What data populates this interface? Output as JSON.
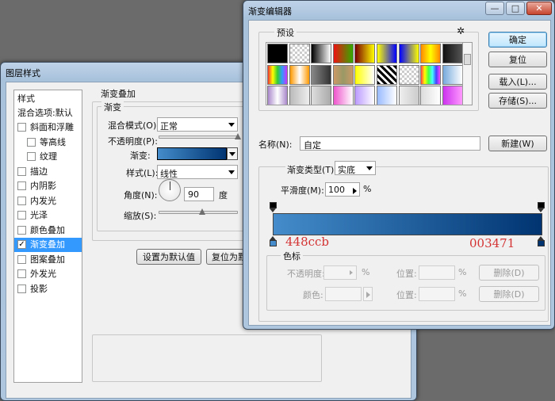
{
  "layer_style": {
    "title": "图层样式",
    "styles_header": "样式",
    "blend_options": "混合选项:默认",
    "items": [
      {
        "label": "斜面和浮雕",
        "checked": false,
        "indent": false,
        "selected": false
      },
      {
        "label": "等高线",
        "checked": false,
        "indent": true,
        "selected": false
      },
      {
        "label": "纹理",
        "checked": false,
        "indent": true,
        "selected": false
      },
      {
        "label": "描边",
        "checked": false,
        "indent": false,
        "selected": false
      },
      {
        "label": "内阴影",
        "checked": false,
        "indent": false,
        "selected": false
      },
      {
        "label": "内发光",
        "checked": false,
        "indent": false,
        "selected": false
      },
      {
        "label": "光泽",
        "checked": false,
        "indent": false,
        "selected": false
      },
      {
        "label": "颜色叠加",
        "checked": false,
        "indent": false,
        "selected": false
      },
      {
        "label": "渐变叠加",
        "checked": true,
        "indent": false,
        "selected": true
      },
      {
        "label": "图案叠加",
        "checked": false,
        "indent": false,
        "selected": false
      },
      {
        "label": "外发光",
        "checked": false,
        "indent": false,
        "selected": false
      },
      {
        "label": "投影",
        "checked": false,
        "indent": false,
        "selected": false
      }
    ],
    "panel_title": "渐变叠加",
    "group_title": "渐变",
    "blend_mode_label": "混合模式(O):",
    "blend_mode_value": "正常",
    "opacity_label": "不透明度(P):",
    "opacity_level": 1.0,
    "gradient_label": "渐变:",
    "style_label": "样式(L):",
    "style_value": "线性",
    "angle_label": "角度(N):",
    "angle_value": "90",
    "angle_unit": "度",
    "scale_label": "缩放(S):",
    "scale_level": 0.55,
    "btn_set_default": "设置为默认值",
    "btn_reset_default": "复位为默"
  },
  "gradient_editor": {
    "title": "渐变编辑器",
    "window_buttons": {
      "minimize": "—",
      "maximize": "□",
      "close": "✕"
    },
    "presets_label": "预设",
    "gear_icon": "✲",
    "btn_ok": "确定",
    "btn_reset": "复位",
    "btn_load": "载入(L)...",
    "btn_save": "存储(S)...",
    "name_label": "名称(N):",
    "name_value": "自定",
    "btn_new": "新建(W)",
    "gradient_type_label": "渐变类型(T):",
    "gradient_type_value": "实底",
    "smoothness_label": "平滑度(M):",
    "smoothness_value": "100",
    "smoothness_unit": "%",
    "color_stop_left_note": "448ccb",
    "color_stop_right_note": "003471",
    "color_left": "#448ccb",
    "color_right": "#003471",
    "stops_group_title": "色标",
    "stop_opacity_label": "不透明度:",
    "percent_unit": "%",
    "position_label": "位置:",
    "delete_label": "删除(D)",
    "stop_color_label": "颜色:",
    "presets": [
      "linear-gradient(90deg,#000,#000)",
      "repeating-conic-gradient(#ccc 0 25%,#fff 0 50%) 0 0/6px 6px",
      "linear-gradient(90deg,#000,#fff)",
      "linear-gradient(90deg,#e11,#3a0)",
      "linear-gradient(90deg,#7a0000,#ff0)",
      "linear-gradient(90deg,#ff0,#00f)",
      "linear-gradient(90deg,#00f,#ff0)",
      "linear-gradient(90deg,#f80,#ff0,#f80)",
      "linear-gradient(90deg,#111,#555)",
      "linear-gradient(90deg,#e33,#ff0,#3c3,#39f,#c3f)",
      "linear-gradient(90deg,#f90,#fff,#f90)",
      "linear-gradient(90deg,#888,#333)",
      "linear-gradient(90deg,#c96,#996,#c96)",
      "linear-gradient(90deg,#ff0,#fff)",
      "repeating-linear-gradient(45deg,#000 0 3px,#fff 3px 6px)",
      "repeating-conic-gradient(#ccc 0 25%,#fff 0 50%) 0 0/6px 6px",
      "linear-gradient(90deg,#f44,#ff0,#4f4,#4ff,#44f,#f4f)",
      "linear-gradient(90deg,#7ad,#fff)",
      "linear-gradient(90deg,#a8c,#fff,#a8c)",
      "linear-gradient(90deg,#bbb,#eee)",
      "linear-gradient(90deg,#ddd,#aaa)",
      "linear-gradient(90deg,#e5c,#fff)",
      "linear-gradient(90deg,#b9f,#fff)",
      "linear-gradient(90deg,#9bf,#fff)",
      "linear-gradient(90deg,#eee,#ccc)",
      "linear-gradient(90deg,#ddd,#fff)",
      "linear-gradient(90deg,#c3e,#f9f)",
      "linear-gradient(90deg,#69f,#bdf)",
      "linear-gradient(90deg,#ccd,#fff)",
      "linear-gradient(90deg,#eee,#fff)",
      "linear-gradient(90deg,#f9c,#fcf)",
      "linear-gradient(90deg,#cdf,#eef)"
    ]
  }
}
